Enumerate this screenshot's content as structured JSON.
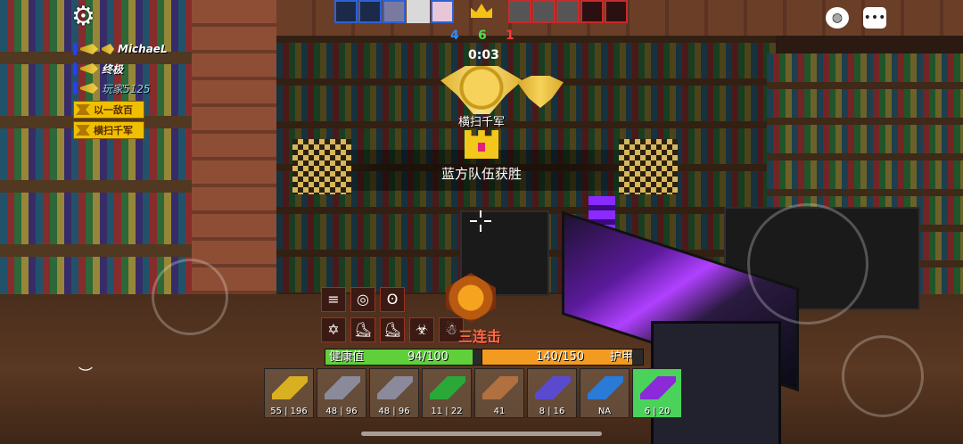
{
  "hud": {
    "settings_icon": "gear-icon",
    "kill_feed": [
      {
        "name": "MichaeL",
        "style": "white"
      },
      {
        "name": "终极",
        "style": "white"
      },
      {
        "name": "玩家5125",
        "style": "cyan"
      }
    ],
    "awards": [
      "以一敌百",
      "横扫千军"
    ],
    "score": {
      "blue": "4",
      "center": "6",
      "red": "1"
    },
    "timer": "0:03",
    "kill_title": "横扫千军",
    "victory_text": "蓝方队伍获胜",
    "streak_text": "三连击",
    "health": {
      "label": "健康值",
      "value_text": "94/100",
      "fraction": 0.94
    },
    "armor": {
      "label": "护甲",
      "value_text": "140/150",
      "fraction": 0.933
    },
    "weapons": [
      {
        "ammo": "55 | 196",
        "color": "#d8b020"
      },
      {
        "ammo": "48 | 96",
        "color": "#8a8a9a"
      },
      {
        "ammo": "48 | 96",
        "color": "#8a8a9a"
      },
      {
        "ammo": "11 | 22",
        "color": "#2aa838"
      },
      {
        "ammo": "41",
        "color": "#b07040"
      },
      {
        "ammo": "8 | 16",
        "color": "#5a4ad0"
      },
      {
        "ammo": "NA",
        "color": "#2a7ad8"
      },
      {
        "ammo": "6 | 20",
        "color": "#8a2ad8",
        "active": true
      }
    ],
    "colors": {
      "blue_team": "#2b63d6",
      "red_team": "#c92a2a",
      "gold": "#f2c214",
      "hp": "#5fd03a",
      "armor": "#f39a20"
    }
  }
}
